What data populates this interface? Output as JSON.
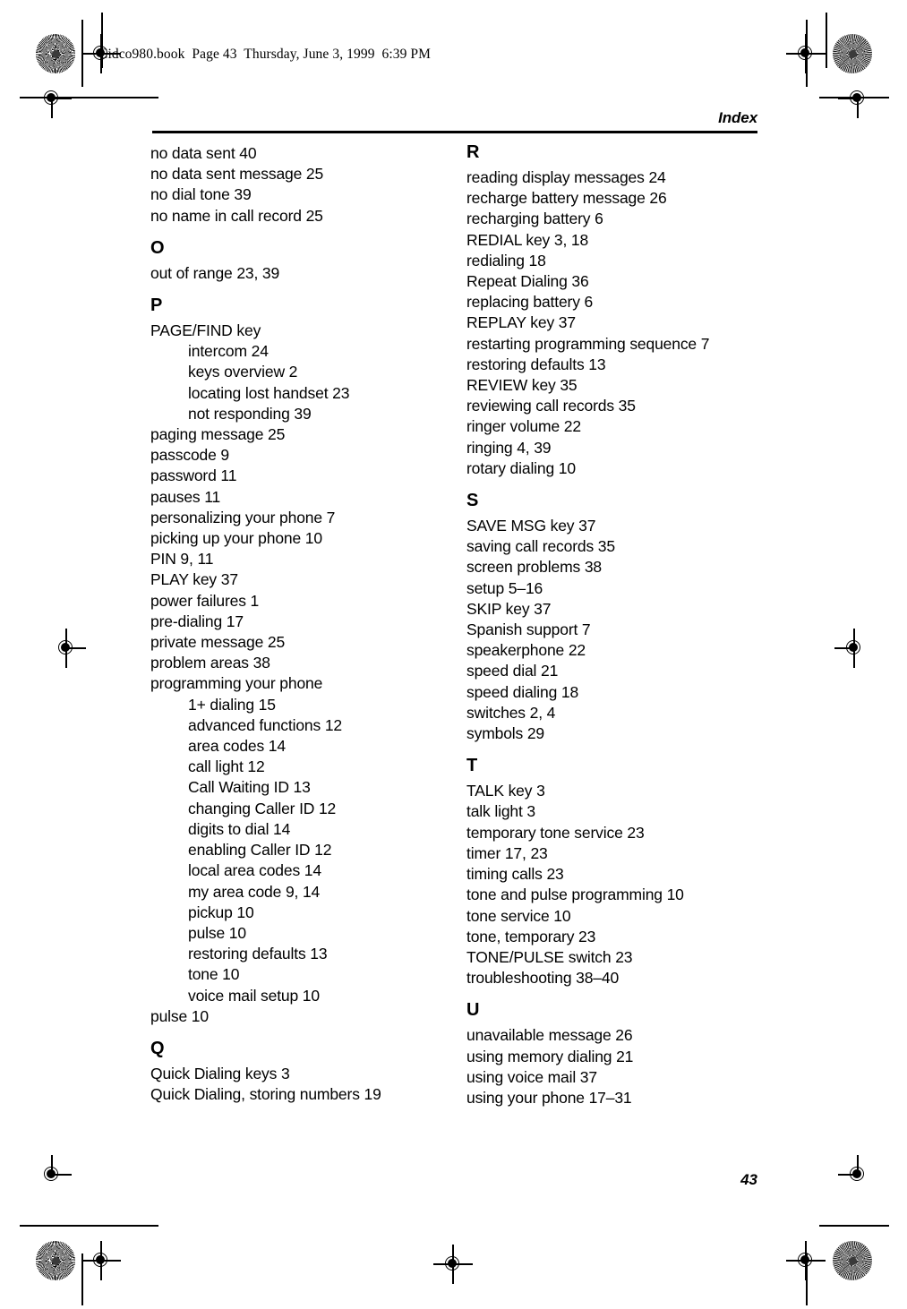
{
  "page": {
    "file_stamp": "Cidco980.book  Page 43  Thursday, June 3, 1999  6:39 PM",
    "running_head": "Index",
    "folio": "43"
  },
  "index": {
    "left_column": [
      {
        "type": "entry",
        "text": "no data sent 40"
      },
      {
        "type": "entry",
        "text": "no data sent message 25"
      },
      {
        "type": "entry",
        "text": "no dial tone 39"
      },
      {
        "type": "entry",
        "text": "no name in call record 25"
      },
      {
        "type": "letter",
        "text": "O"
      },
      {
        "type": "entry",
        "text": "out of range 23, 39"
      },
      {
        "type": "letter",
        "text": "P"
      },
      {
        "type": "entry",
        "text": "PAGE/FIND key"
      },
      {
        "type": "sub",
        "text": "intercom 24"
      },
      {
        "type": "sub",
        "text": "keys overview 2"
      },
      {
        "type": "sub",
        "text": "locating lost handset 23"
      },
      {
        "type": "sub",
        "text": "not responding 39"
      },
      {
        "type": "entry",
        "text": "paging message 25"
      },
      {
        "type": "entry",
        "text": "passcode 9"
      },
      {
        "type": "entry",
        "text": "password 11"
      },
      {
        "type": "entry",
        "text": "pauses 11"
      },
      {
        "type": "entry",
        "text": "personalizing your phone 7"
      },
      {
        "type": "entry",
        "text": "picking up your phone 10"
      },
      {
        "type": "entry",
        "text": "PIN 9, 11"
      },
      {
        "type": "entry",
        "text": "PLAY key 37"
      },
      {
        "type": "entry",
        "text": "power failures 1"
      },
      {
        "type": "entry",
        "text": "pre-dialing 17"
      },
      {
        "type": "entry",
        "text": "private message 25"
      },
      {
        "type": "entry",
        "text": "problem areas 38"
      },
      {
        "type": "entry",
        "text": "programming your phone"
      },
      {
        "type": "sub",
        "text": "1+ dialing 15"
      },
      {
        "type": "sub",
        "text": "advanced functions 12"
      },
      {
        "type": "sub",
        "text": "area codes 14"
      },
      {
        "type": "sub",
        "text": "call light 12"
      },
      {
        "type": "sub",
        "text": "Call Waiting ID 13"
      },
      {
        "type": "sub",
        "text": "changing Caller ID 12"
      },
      {
        "type": "sub",
        "text": "digits to dial 14"
      },
      {
        "type": "sub",
        "text": "enabling Caller ID 12"
      },
      {
        "type": "sub",
        "text": "local area codes 14"
      },
      {
        "type": "sub",
        "text": "my area code 9, 14"
      },
      {
        "type": "sub",
        "text": "pickup 10"
      },
      {
        "type": "sub",
        "text": "pulse 10"
      },
      {
        "type": "sub",
        "text": "restoring defaults 13"
      },
      {
        "type": "sub",
        "text": "tone 10"
      },
      {
        "type": "sub",
        "text": "voice mail setup 10"
      },
      {
        "type": "entry",
        "text": "pulse 10"
      },
      {
        "type": "letter",
        "text": "Q"
      },
      {
        "type": "entry",
        "text": "Quick Dialing keys 3"
      },
      {
        "type": "entry",
        "text": "Quick Dialing, storing numbers 19"
      }
    ],
    "right_column": [
      {
        "type": "letter",
        "text": "R"
      },
      {
        "type": "entry",
        "text": "reading display messages 24"
      },
      {
        "type": "entry",
        "text": "recharge battery message 26"
      },
      {
        "type": "entry",
        "text": "recharging battery 6"
      },
      {
        "type": "entry",
        "text": "REDIAL key 3, 18"
      },
      {
        "type": "entry",
        "text": "redialing 18"
      },
      {
        "type": "entry",
        "text": "Repeat Dialing 36"
      },
      {
        "type": "entry",
        "text": "replacing battery 6"
      },
      {
        "type": "entry",
        "text": "REPLAY key 37"
      },
      {
        "type": "entry",
        "text": "restarting programming sequence 7"
      },
      {
        "type": "entry",
        "text": "restoring defaults 13"
      },
      {
        "type": "entry",
        "text": "REVIEW key 35"
      },
      {
        "type": "entry",
        "text": "reviewing call records 35"
      },
      {
        "type": "entry",
        "text": "ringer volume 22"
      },
      {
        "type": "entry",
        "text": "ringing 4, 39"
      },
      {
        "type": "entry",
        "text": "rotary dialing 10"
      },
      {
        "type": "letter",
        "text": "S"
      },
      {
        "type": "entry",
        "text": "SAVE MSG key 37"
      },
      {
        "type": "entry",
        "text": "saving call records 35"
      },
      {
        "type": "entry",
        "text": "screen problems 38"
      },
      {
        "type": "entry",
        "text": "setup 5–16"
      },
      {
        "type": "entry",
        "text": "SKIP key 37"
      },
      {
        "type": "entry",
        "text": "Spanish support 7"
      },
      {
        "type": "entry",
        "text": "speakerphone 22"
      },
      {
        "type": "entry",
        "text": "speed dial 21"
      },
      {
        "type": "entry",
        "text": "speed dialing 18"
      },
      {
        "type": "entry",
        "text": "switches 2, 4"
      },
      {
        "type": "entry",
        "text": "symbols 29"
      },
      {
        "type": "letter",
        "text": "T"
      },
      {
        "type": "entry",
        "text": "TALK key 3"
      },
      {
        "type": "entry",
        "text": "talk light 3"
      },
      {
        "type": "entry",
        "text": "temporary tone service 23"
      },
      {
        "type": "entry",
        "text": "timer 17, 23"
      },
      {
        "type": "entry",
        "text": "timing calls 23"
      },
      {
        "type": "entry",
        "text": "tone and pulse programming 10"
      },
      {
        "type": "entry",
        "text": "tone service 10"
      },
      {
        "type": "entry",
        "text": "tone, temporary 23"
      },
      {
        "type": "entry",
        "text": "TONE/PULSE switch 23"
      },
      {
        "type": "entry",
        "text": "troubleshooting 38–40"
      },
      {
        "type": "letter",
        "text": "U"
      },
      {
        "type": "entry",
        "text": "unavailable message 26"
      },
      {
        "type": "entry",
        "text": "using memory dialing 21"
      },
      {
        "type": "entry",
        "text": "using voice mail 37"
      },
      {
        "type": "entry",
        "text": "using your phone 17–31"
      }
    ]
  },
  "print_marks": {
    "registration_marks": 10,
    "starburst_marks": 4,
    "ink_color": "#000000"
  }
}
